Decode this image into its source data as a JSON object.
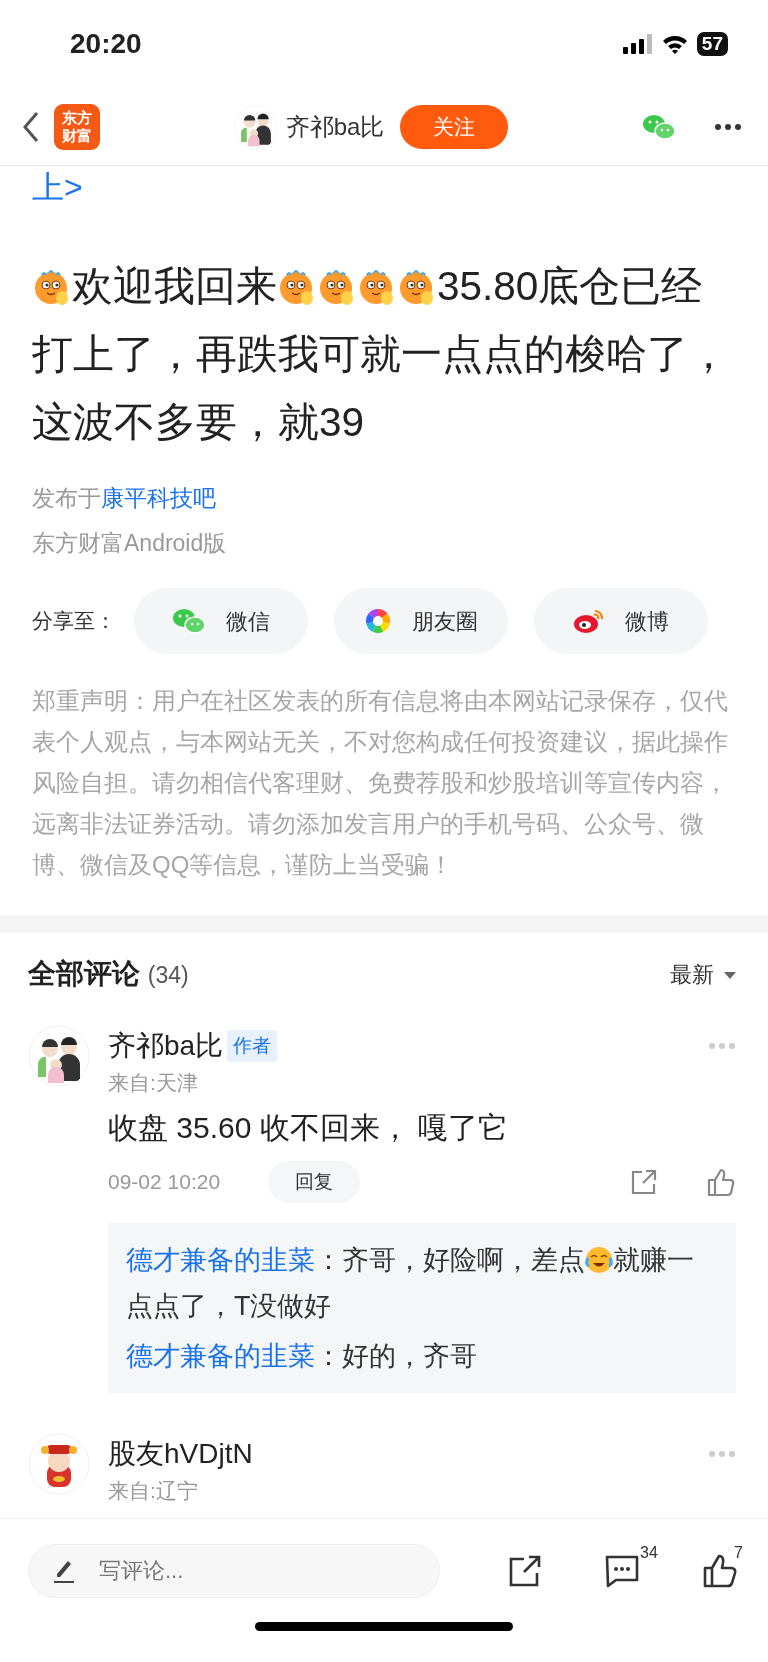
{
  "status_bar": {
    "time": "20:20",
    "battery": "57"
  },
  "nav": {
    "logo_lines": [
      "东方",
      "财富"
    ],
    "author": "齐祁ba比",
    "follow": "关注"
  },
  "post": {
    "link_cut": "上>",
    "body": [
      {
        "kind": "emoji"
      },
      {
        "kind": "text",
        "text": "欢迎我回来"
      },
      {
        "kind": "emoji"
      },
      {
        "kind": "emoji"
      },
      {
        "kind": "emoji"
      },
      {
        "kind": "emoji"
      },
      {
        "kind": "text",
        "text": "35.80底仓已经打上了，再跌我可就一点点的梭哈了，这波不多要，就39"
      }
    ],
    "published_prefix": "发布于",
    "forum": "康平科技吧",
    "source": "东方财富Android版"
  },
  "share": {
    "label": "分享至：",
    "targets": [
      {
        "kind": "wechat",
        "label": "微信"
      },
      {
        "kind": "moments",
        "label": "朋友圈"
      },
      {
        "kind": "weibo",
        "label": "微博"
      }
    ]
  },
  "disclaimer": "郑重声明：用户在社区发表的所有信息将由本网站记录保存，仅代表个人观点，与本网站无关，不对您构成任何投资建议，据此操作风险自担。请勿相信代客理财、免费荐股和炒股培训等宣传内容，远离非法证券活动。请勿添加发言用户的手机号码、公众号、微博、微信及QQ等信息，谨防上当受骗！",
  "comments_header": {
    "title": "全部评论",
    "count": "(34)",
    "sort": "最新"
  },
  "comments": [
    {
      "name": "齐祁ba比",
      "badge": "作者",
      "location": "来自:天津",
      "text": "收盘 35.60 收不回来， 嘎了它",
      "time": "09-02 10:20",
      "reply_button": "回复",
      "replies": [
        {
          "user": "德才兼备的韭菜",
          "segments": [
            {
              "kind": "text",
              "text": "：齐哥，好险啊，差点"
            },
            {
              "kind": "emoji"
            },
            {
              "kind": "text",
              "text": "就赚一点点了，T没做好"
            }
          ]
        },
        {
          "user": "德才兼备的韭菜",
          "segments": [
            {
              "kind": "text",
              "text": "：好的，齐哥"
            }
          ]
        }
      ]
    },
    {
      "name": "股友hVDjtN",
      "location": "来自:辽宁"
    }
  ],
  "bottom_bar": {
    "placeholder": "写评论...",
    "comment_count": "34",
    "like_count": "7"
  }
}
